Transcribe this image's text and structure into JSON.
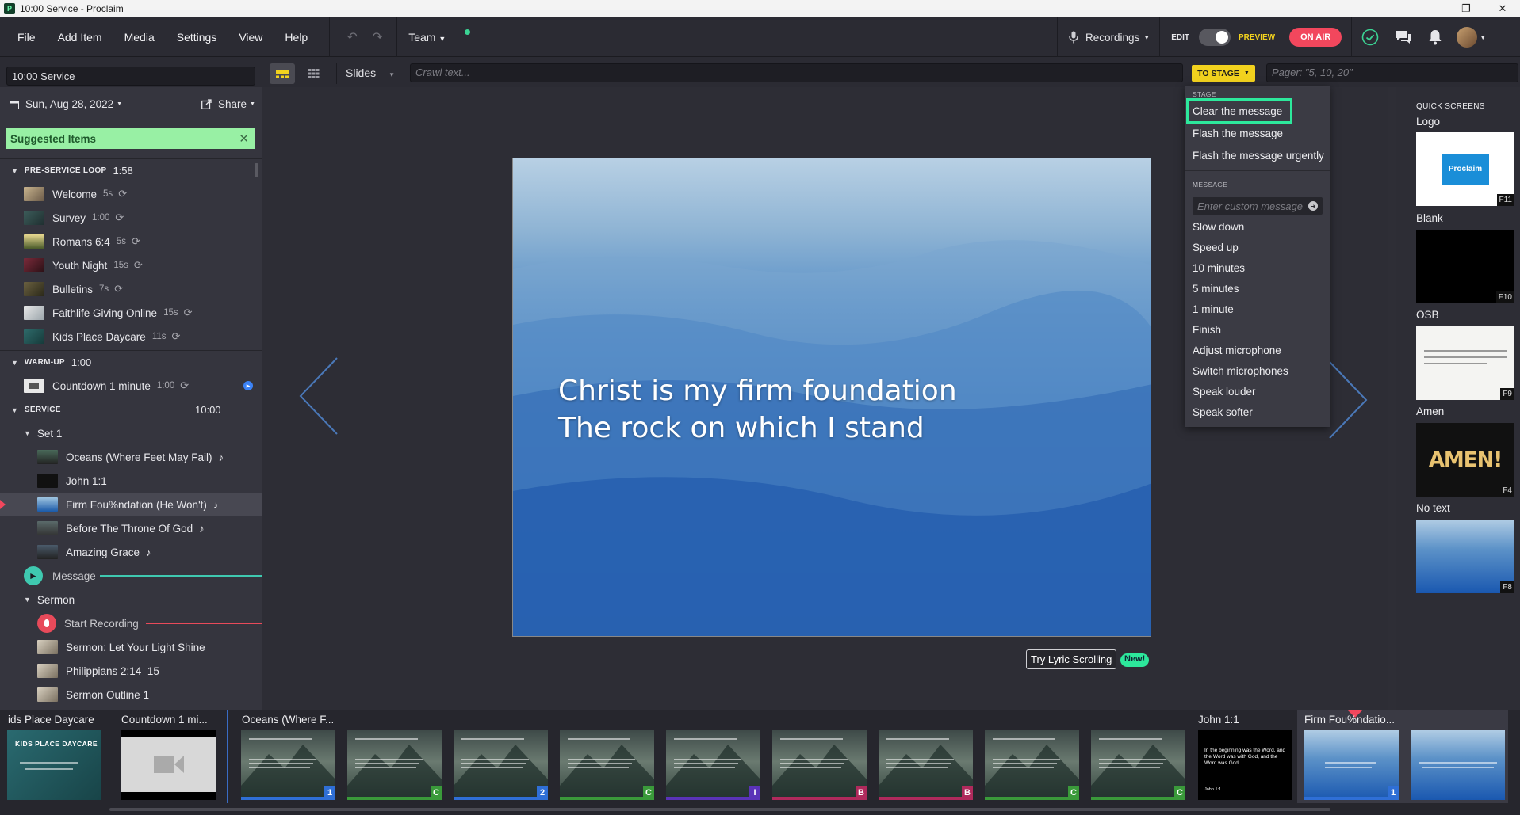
{
  "window": {
    "title": "10:00 Service - Proclaim",
    "app_icon": "P"
  },
  "menubar": {
    "items": [
      "File",
      "Add Item",
      "Media",
      "Settings",
      "View",
      "Help"
    ],
    "team_label": "Team",
    "recordings_label": "Recordings",
    "edit_label": "EDIT",
    "preview_label": "PREVIEW",
    "on_air_label": "ON AIR"
  },
  "toolbar": {
    "service_name": "10:00 Service",
    "slides_label": "Slides",
    "crawl_placeholder": "Crawl text...",
    "to_stage_label": "TO STAGE",
    "pager_placeholder": "Pager: \"5, 10, 20\""
  },
  "service": {
    "date": "Sun, Aug 28, 2022",
    "share_label": "Share",
    "suggested_label": "Suggested Items",
    "pre_service": {
      "label": "PRE-SERVICE LOOP",
      "duration": "1:58",
      "items": [
        {
          "name": "Welcome",
          "dur": "5s"
        },
        {
          "name": "Survey",
          "dur": "1:00"
        },
        {
          "name": "Romans 6:4",
          "dur": "5s"
        },
        {
          "name": "Youth Night",
          "dur": "15s"
        },
        {
          "name": "Bulletins",
          "dur": "7s"
        },
        {
          "name": "Faithlife Giving Online",
          "dur": "15s"
        },
        {
          "name": "Kids Place Daycare",
          "dur": "11s"
        }
      ]
    },
    "warmup": {
      "label": "WARM-UP",
      "duration": "1:00",
      "items": [
        {
          "name": "Countdown 1 minute",
          "dur": "1:00"
        }
      ]
    },
    "main": {
      "label": "SERVICE",
      "duration": "10:00",
      "set_label": "Set 1",
      "set_items": [
        "Oceans (Where Feet May Fail)",
        "John 1:1",
        "Firm Fou%ndation (He Won't)",
        "Before The Throne Of God",
        "Amazing Grace"
      ],
      "message_label": "Message",
      "sermon_label": "Sermon",
      "sermon_items": [
        "Start Recording",
        "Sermon: Let Your Light Shine",
        "Philippians 2:14–15",
        "Sermon Outline 1"
      ]
    }
  },
  "preview": {
    "lyric_line1": "Christ is my firm foundation",
    "lyric_line2": "The rock on which I stand",
    "lyric_scroll_label": "Try Lyric Scrolling",
    "new_badge": "New!"
  },
  "stage_menu": {
    "stage_section": "STAGE",
    "stage_items": [
      "Clear the message",
      "Flash the message",
      "Flash the message urgently"
    ],
    "message_section": "MESSAGE",
    "custom_placeholder": "Enter custom message",
    "message_items": [
      "Slow down",
      "Speed up",
      "10 minutes",
      "5 minutes",
      "1 minute",
      "Finish",
      "Adjust microphone",
      "Switch microphones",
      "Speak louder",
      "Speak softer"
    ]
  },
  "quick_screens": {
    "header": "QUICK SCREENS",
    "items": [
      {
        "label": "Logo",
        "key": "F11",
        "thumb_text": "Proclaim"
      },
      {
        "label": "Blank",
        "key": "F10"
      },
      {
        "label": "OSB",
        "key": "F9"
      },
      {
        "label": "Amen",
        "key": "F4",
        "thumb_text": "AMEN!"
      },
      {
        "label": "No text",
        "key": "F8"
      }
    ]
  },
  "slide_strip": {
    "groups": [
      {
        "title": "ids Place Daycare",
        "thumb_text": "KIDS PLACE DAYCARE"
      },
      {
        "title": "Countdown 1 mi..."
      },
      {
        "title": "Oceans (Where F..."
      },
      {
        "title": "John 1:1"
      },
      {
        "title": "Firm Fou%ndatio..."
      }
    ],
    "oceans_slides": [
      {
        "badge": "1",
        "color": "#2f6fd6"
      },
      {
        "badge": "C",
        "color": "#3a9a3a"
      },
      {
        "badge": "2",
        "color": "#2f6fd6"
      },
      {
        "badge": "C",
        "color": "#3a9a3a"
      },
      {
        "badge": "I",
        "color": "#5a33b8"
      },
      {
        "badge": "B",
        "color": "#b02a5c"
      },
      {
        "badge": "B",
        "color": "#b02a5c"
      },
      {
        "badge": "C",
        "color": "#3a9a3a"
      },
      {
        "badge": "C",
        "color": "#3a9a3a"
      }
    ],
    "john_text": "In the beginning was the Word, and the Word was with God, and the Word was God.",
    "john_ref": "John 1:1",
    "firm_badge": "1"
  },
  "colors": {
    "accent_green": "#3bd494",
    "on_air": "#f2475d",
    "to_stage": "#f2d21e",
    "highlight": "#2de89c"
  }
}
